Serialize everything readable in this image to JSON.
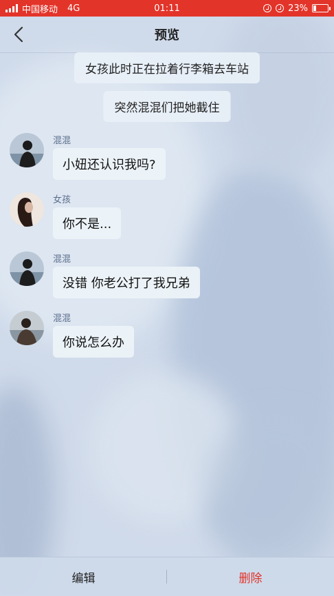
{
  "status_bar": {
    "carrier": "中国移动",
    "network": "4G",
    "time": "01:11",
    "battery_text": "23%",
    "battery_level": 0.23,
    "signal_icon": "signal-bars-icon",
    "alarm_icon": "alarm-icon",
    "rotation_icon": "rotation-lock-icon",
    "battery_icon": "battery-icon",
    "bar_color": "#e3342a"
  },
  "nav": {
    "back_icon": "chevron-left-icon",
    "title": "预览"
  },
  "chat": {
    "narrations": [
      {
        "text": "女孩此时正在拉着行李箱去车站"
      },
      {
        "text": "突然混混们把她截住"
      }
    ],
    "messages": [
      {
        "sender": "混混",
        "text": "小妞还认识我吗?"
      },
      {
        "sender": "女孩",
        "text": "你不是..."
      },
      {
        "sender": "混混",
        "text": "没错 你老公打了我兄弟"
      },
      {
        "sender": "混混",
        "text": "你说怎么办"
      }
    ]
  },
  "bottom_bar": {
    "edit_label": "编辑",
    "delete_label": "删除",
    "delete_color": "#e3342a"
  }
}
